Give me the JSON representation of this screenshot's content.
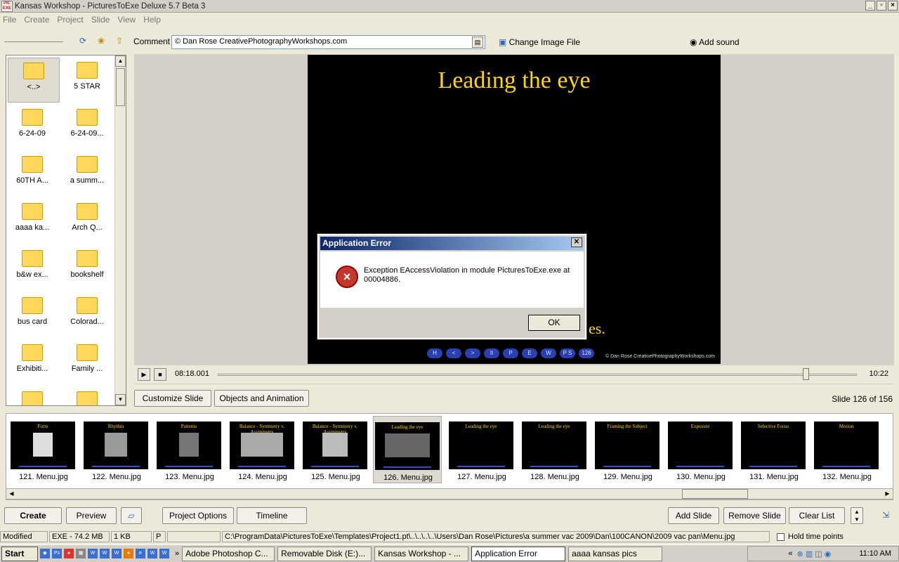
{
  "window": {
    "title": "Kansas Workshop - PicturesToExe Deluxe 5.7 Beta 3",
    "icon_text": "PIC EXE",
    "min": "_",
    "max": "▫",
    "close": "×"
  },
  "menu": [
    "File",
    "Create",
    "Project",
    "Slide",
    "View",
    "Help"
  ],
  "toolbar": {
    "comment_label": "Comment",
    "comment_value": "© Dan Rose CreativePhotographyWorkshops.com",
    "change_image": "Change Image File",
    "add_sound": "Add sound"
  },
  "folders": [
    "<..>",
    "5 STAR",
    "6-24-09",
    "6-24-09...",
    "60TH A...",
    "a summ...",
    "aaaa ka...",
    "Arch Q...",
    "b&w ex...",
    "bookshelf",
    "bus card",
    "Colorad...",
    "Exhibiti...",
    "Family ...",
    "",
    ""
  ],
  "slide": {
    "title": "Leading the eye",
    "bottom_text": "es.",
    "credit": "© Dan Rose CreativePhotographyWorkshops.com",
    "nav": [
      "H",
      "<",
      ">",
      "II",
      "P",
      "E",
      "W",
      "P S",
      "126"
    ]
  },
  "player": {
    "play": "▶",
    "stop": "■",
    "current_time": "08:18.001",
    "total_time": "10:22",
    "position_fraction": 0.92
  },
  "dialog": {
    "title": "Application Error",
    "message": "Exception EAccessViolation in module PicturesToExe.exe at 00004886.",
    "ok": "OK",
    "icon": "×"
  },
  "midbar": {
    "customize": "Customize Slide",
    "objects": "Objects and Animation",
    "slide_count": "Slide 126 of 156"
  },
  "thumbnails": [
    {
      "caption": "121. Menu.jpg",
      "title": "Form"
    },
    {
      "caption": "122. Menu.jpg",
      "title": "Rhythm"
    },
    {
      "caption": "123. Menu.jpg",
      "title": "Patterns"
    },
    {
      "caption": "124. Menu.jpg",
      "title": "Balance - Symmetry v. Asymmetry"
    },
    {
      "caption": "125. Menu.jpg",
      "title": "Balance - Symmetry v. Asymmetry"
    },
    {
      "caption": "126. Menu.jpg",
      "title": "Leading the eye"
    },
    {
      "caption": "127. Menu.jpg",
      "title": "Leading the eye"
    },
    {
      "caption": "128. Menu.jpg",
      "title": "Leading the eye"
    },
    {
      "caption": "129. Menu.jpg",
      "title": "Framing the Subject"
    },
    {
      "caption": "130. Menu.jpg",
      "title": "Exposure"
    },
    {
      "caption": "131. Menu.jpg",
      "title": "Selective Focus"
    },
    {
      "caption": "132. Menu.jpg",
      "title": "Motion"
    }
  ],
  "bottom": {
    "create": "Create",
    "preview": "Preview",
    "project_options": "Project Options",
    "timeline": "Timeline",
    "add_slide": "Add Slide",
    "remove_slide": "Remove Slide",
    "clear_list": "Clear List"
  },
  "status": {
    "modified": "Modified",
    "exe": "EXE - 74.2 MB",
    "size": "1 KB",
    "p": "P",
    "path": "C:\\ProgramData\\PicturesToExe\\Templates\\Project1.pt\\..\\..\\..\\..\\Users\\Dan Rose\\Pictures\\a summer vac 2009\\Dan\\100CANON\\2009 vac pan\\Menu.jpg",
    "hold": "Hold time points"
  },
  "taskbar": {
    "start": "Start",
    "tasks": [
      "Adobe Photoshop C...",
      "Removable Disk (E:)...",
      "Kansas Workshop - ...",
      "Application Error",
      "aaaa kansas pics"
    ],
    "clock": "11:10 AM"
  }
}
